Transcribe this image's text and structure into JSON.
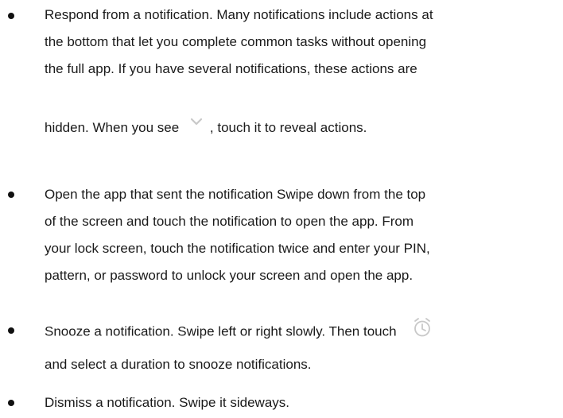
{
  "items": [
    {
      "line1": "Respond from a notification. Many notifications include actions at",
      "line2": "the bottom that let you complete common tasks without opening",
      "line3": "the full app. If you have several notifications, these actions are",
      "tail_before": "hidden. When you see",
      "tail_after": ", touch it to reveal actions.",
      "icon": "chevron-down-icon"
    },
    {
      "line1": "Open the app that sent the notification Swipe down from the top",
      "line2": "of the screen and touch the notification to open the app. From",
      "line3": "your lock screen, touch the notification twice and enter your PIN,",
      "line4": "pattern, or password to unlock your screen and open the app."
    },
    {
      "line1": "Snooze a notification. Swipe left or right slowly. Then touch",
      "line2": "and select a duration to snooze notifications.",
      "icon": "alarm-clock-icon"
    },
    {
      "line1": "Dismiss a notification. Swipe it sideways."
    }
  ],
  "colors": {
    "text": "#1a1a1a",
    "icon": "#c8c8c8"
  }
}
